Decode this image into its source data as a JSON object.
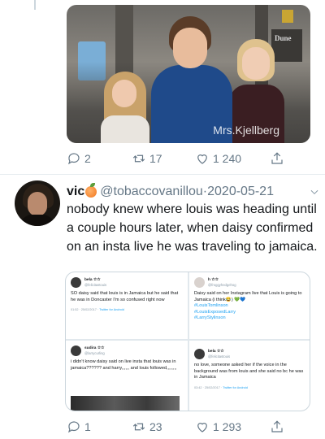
{
  "tweet1": {
    "watermark": "Mrs.Kjellberg",
    "actions": {
      "replies": "2",
      "retweets": "17",
      "likes": "1 240"
    }
  },
  "tweet2": {
    "name": "vic",
    "handle": "@tobaccovanillou",
    "separator": "·",
    "date": "2020-05-21",
    "text": "nobody knew where louis was heading until a couple hours later, when daisy confirmed on an insta live he was traveling to jamaica.",
    "actions": {
      "replies": "1",
      "retweets": "23",
      "likes": "1 293"
    },
    "collage": [
      {
        "name": "bela ☆☆",
        "handle": "@felicitastouis",
        "text": "SO daisy said that louis is in Jamaica but he said that he was in Doncaster I'm so confused right now",
        "time": "01:52 · 25/02/2017 ·",
        "client": "Twitter for Android"
      },
      {
        "name": "h ☆☆",
        "handle": "@froggyhedgehog",
        "text": "Daisy said on her Instagram live that Louis is going to Jamaica (i think😂) 💚💙",
        "tags": [
          "#LouisTomlinson",
          "#LouisExposedLarry",
          "#LarryStylinson"
        ]
      },
      {
        "name": "sudira ☆☆",
        "handle": "@larrycurling",
        "text": "i didn't know daisy said on live insta that louis was in jamaica?????? and harry,,,,,, and louis followed,,,,,,,,"
      },
      {
        "name": "bela ☆☆",
        "handle": "@felicitastouis",
        "text": "no love, someone asked her if the voice in the background was from louis and she said no bc he was in Jamaica",
        "time": "03:42 · 25/02/2017 ·",
        "client": "Twitter for Android"
      }
    ]
  },
  "icons": [
    "reply-icon",
    "retweet-icon",
    "like-icon",
    "share-icon",
    "chevron-down-icon"
  ],
  "colors": {
    "text": "#14171a",
    "muted": "#657786",
    "link": "#1da1f2",
    "border": "#e6ecf0"
  }
}
